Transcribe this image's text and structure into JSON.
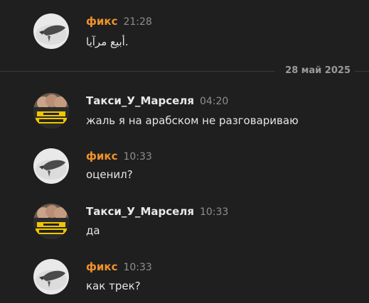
{
  "colors": {
    "background": "#1f1f1f",
    "user_fiks": "#f0932b",
    "user_taxi": "#e8e8e8",
    "timestamp": "#8e8e8e",
    "divider": "#3a3a3a"
  },
  "divider": {
    "date": "28 май 2025"
  },
  "messages": [
    {
      "author": "фикс",
      "time": "21:28",
      "text": "أبيع مرآيا.",
      "avatar": "fish-photo-avatar"
    },
    {
      "author": "Такси_У_Марселя",
      "time": "04:20",
      "text": "жаль я на арабском не разговариваю",
      "avatar": "group-photo-avatar"
    },
    {
      "author": "фикс",
      "time": "10:33",
      "text": "оценил?",
      "avatar": "fish-photo-avatar"
    },
    {
      "author": "Такси_У_Марселя",
      "time": "10:33",
      "text": "да",
      "avatar": "group-photo-avatar"
    },
    {
      "author": "фикс",
      "time": "10:33",
      "text": "как трек?",
      "avatar": "fish-photo-avatar"
    }
  ]
}
